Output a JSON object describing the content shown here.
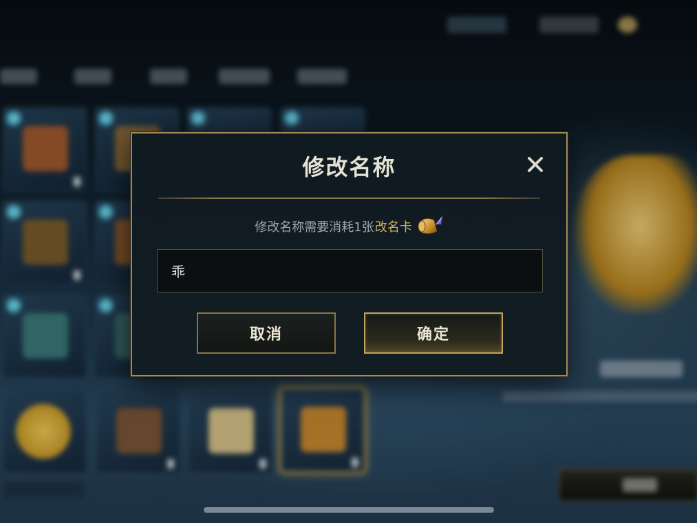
{
  "dialog": {
    "title": "修改名称",
    "cost_text": "修改名称需要消耗1张",
    "cost_item": "改名卡",
    "cost_item_icon": "rename-scroll-icon",
    "input_value": "乖",
    "cancel_label": "取消",
    "confirm_label": "确定",
    "close_icon": "close-icon"
  },
  "colors": {
    "accent_gold": "#c7a35a",
    "highlight_gold": "#d7b25e",
    "dialog_bg": "#0f1a21"
  }
}
